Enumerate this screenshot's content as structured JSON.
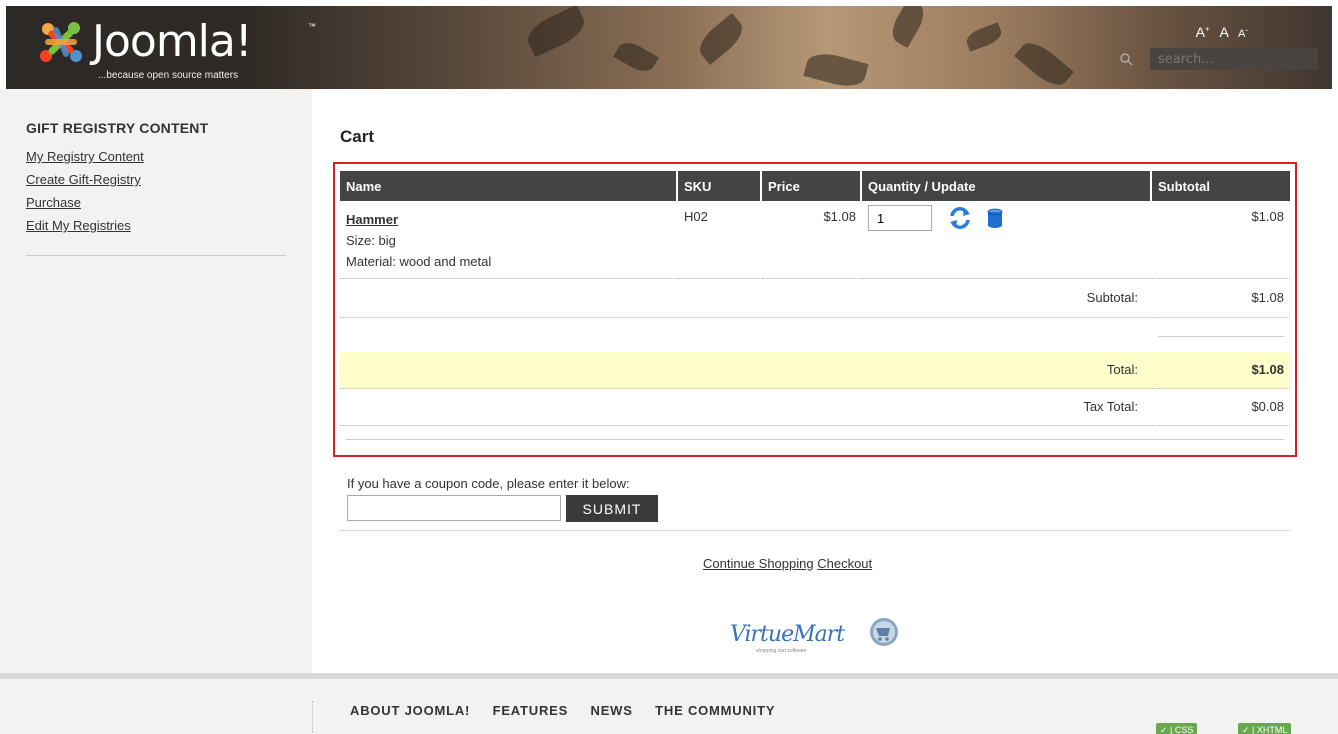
{
  "header": {
    "logo_text": "Joomla!",
    "logo_tm": "™",
    "tagline": "...because open source matters",
    "font_larger": "A",
    "font_larger_sup": "+",
    "font_reset": "A",
    "font_smaller": "A",
    "font_smaller_sup": "-",
    "search_placeholder": "search..."
  },
  "sidebar": {
    "title": "GIFT REGISTRY CONTENT",
    "items": [
      {
        "label": "My Registry Content"
      },
      {
        "label": "Create Gift-Registry"
      },
      {
        "label": "Purchase"
      },
      {
        "label": "Edit My Registries"
      }
    ]
  },
  "main": {
    "title": "Cart",
    "columns": [
      "Name",
      "SKU",
      "Price",
      "Quantity / Update",
      "Subtotal"
    ],
    "item": {
      "name": "Hammer",
      "size": "Size: big",
      "material": "Material: wood and metal",
      "sku": "H02",
      "price": "$1.08",
      "quantity": "1",
      "subtotal": "$1.08"
    },
    "summary": {
      "subtotal_label": "Subtotal:",
      "subtotal_value": "$1.08",
      "total_label": "Total:",
      "total_value": "$1.08",
      "tax_label": "Tax Total:",
      "tax_value": "$0.08"
    },
    "coupon": {
      "label": "If you have a coupon code, please enter it below:",
      "submit": "SUBMIT"
    },
    "links": {
      "continue": "Continue Shopping",
      "checkout": "Checkout"
    },
    "vm_logo": "VirtueMart",
    "vm_sub": "shopping cart software"
  },
  "footer": {
    "nav": [
      "ABOUT JOOMLA!",
      "FEATURES",
      "NEWS",
      "THE COMMUNITY"
    ],
    "badge_css": "CSS",
    "badge_xhtml": "XHTML"
  },
  "colors": {
    "highlight_row": "#ffffcc",
    "cart_border": "#d42026",
    "table_header": "#444444"
  }
}
